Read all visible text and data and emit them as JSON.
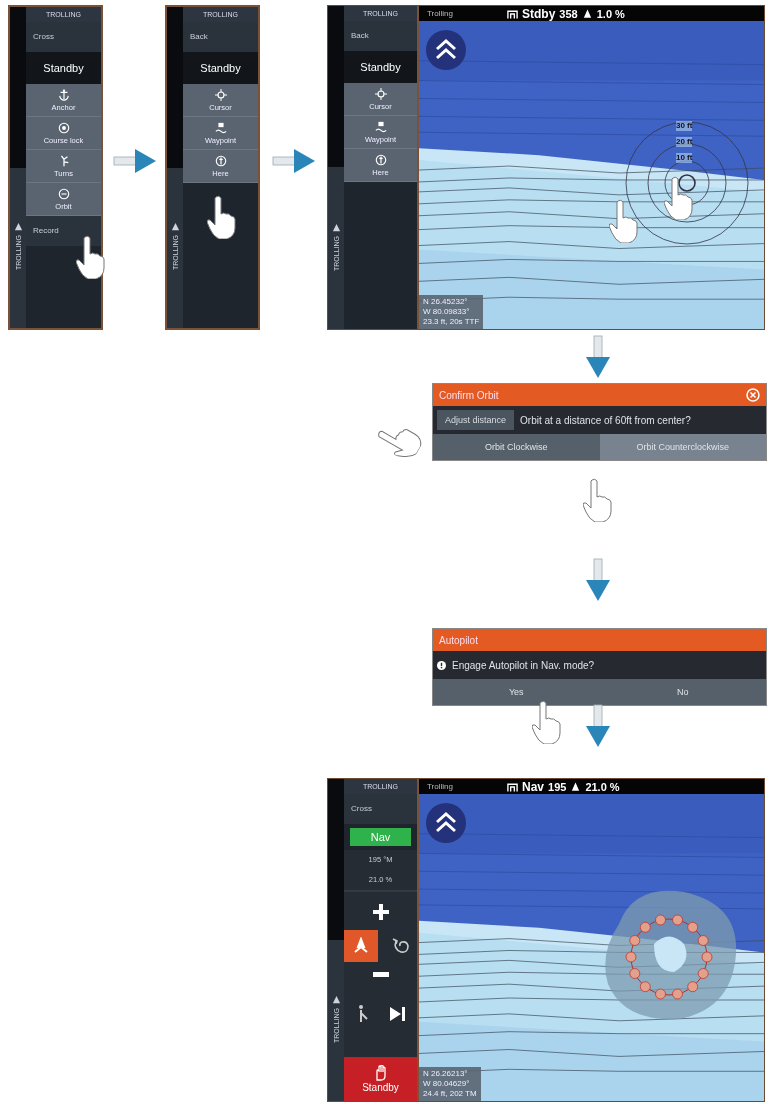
{
  "step_1_menu": {
    "side_label": "TROLLING",
    "header": "TROLLING",
    "items": [
      {
        "kind": "row",
        "label": "Cross"
      },
      {
        "kind": "mode",
        "label": "Standby",
        "engaged": false
      },
      {
        "kind": "option",
        "label": "Anchor"
      },
      {
        "kind": "option",
        "label": "Course lock"
      },
      {
        "kind": "option",
        "label": "Turns"
      },
      {
        "kind": "option",
        "label": "Orbit"
      },
      {
        "kind": "row",
        "label": "Record"
      }
    ]
  },
  "step_2_menu": {
    "side_label": "TROLLING",
    "header": "TROLLING",
    "items": [
      {
        "kind": "row",
        "label": "Back"
      },
      {
        "kind": "mode",
        "label": "Standby",
        "engaged": false
      },
      {
        "kind": "option",
        "label": "Cursor"
      },
      {
        "kind": "option",
        "label": "Waypoint"
      },
      {
        "kind": "option",
        "label": "Here"
      }
    ]
  },
  "step_3_screen": {
    "sidebar": {
      "side_label": "TROLLING",
      "header": "TROLLING",
      "items": [
        {
          "kind": "row",
          "label": "Back"
        },
        {
          "kind": "mode",
          "label": "Standby",
          "engaged": false
        },
        {
          "kind": "option",
          "label": "Cursor"
        },
        {
          "kind": "option",
          "label": "Waypoint"
        },
        {
          "kind": "option",
          "label": "Here"
        }
      ]
    },
    "status_bar": {
      "source": "Trolling",
      "mode": "Stdby",
      "heading": "358",
      "thrust": "1.0 %"
    },
    "range_labels": [
      "30 ft",
      "20 ft",
      "10 ft"
    ],
    "position": [
      "N 26.45232°",
      "W 80.09833°",
      "23.3 ft, 20s TTF"
    ]
  },
  "confirm_orbit_dialog": {
    "title": "Confirm Orbit",
    "adjust_button": "Adjust distance",
    "message": "Orbit at a distance of 60ft from center?",
    "buttons": [
      {
        "label": "Orbit Clockwise",
        "selected": false
      },
      {
        "label": "Orbit Counterclockwise",
        "selected": true
      }
    ]
  },
  "autopilot_dialog": {
    "title": "Autopilot",
    "message": "Engage Autopilot in Nav. mode?",
    "buttons": [
      "Yes",
      "No"
    ]
  },
  "step_4_screen": {
    "sidebar": {
      "side_label": "TROLLING",
      "header": "TROLLING",
      "items": [
        {
          "kind": "row",
          "label": "Cross"
        },
        {
          "kind": "mode",
          "label": "Nav",
          "engaged": true
        },
        {
          "kind": "reading",
          "label": "195 °M"
        },
        {
          "kind": "reading",
          "label": "21.0 %"
        },
        {
          "kind": "pad",
          "buttons": [
            {
              "selected": true
            },
            {
              "selected": false
            }
          ]
        },
        {
          "kind": "stop",
          "label": "Standby"
        }
      ]
    },
    "status_bar": {
      "source": "Trolling",
      "mode": "Nav",
      "heading": "195",
      "thrust": "21.0 %"
    },
    "position": [
      "N 26.26213°",
      "W 80.04629°",
      "24.4 ft, 202 TM"
    ]
  }
}
